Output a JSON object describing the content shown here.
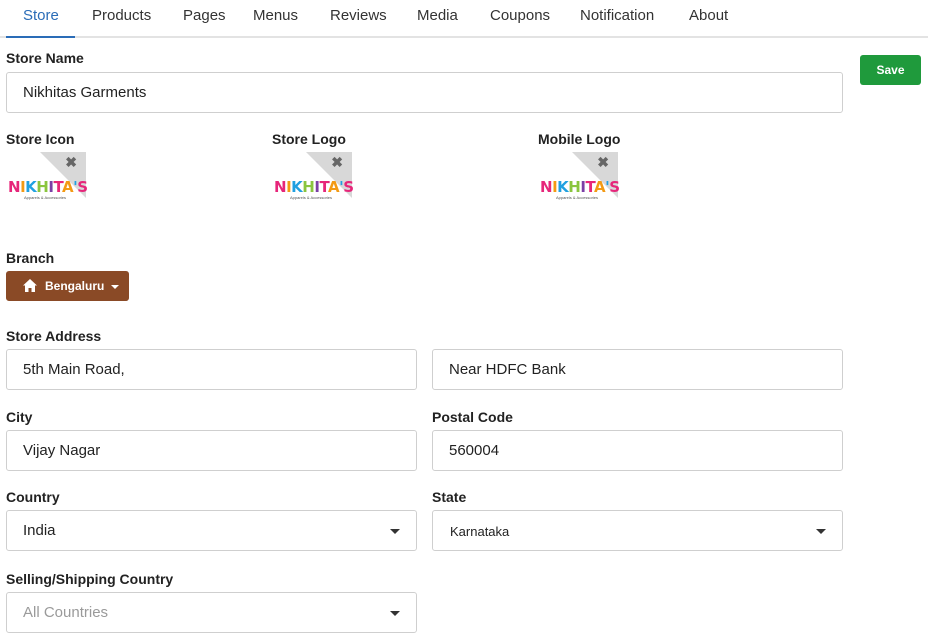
{
  "tabs": [
    {
      "label": "Store",
      "active": true
    },
    {
      "label": "Products"
    },
    {
      "label": "Pages"
    },
    {
      "label": "Menus"
    },
    {
      "label": "Reviews"
    },
    {
      "label": "Media"
    },
    {
      "label": "Coupons"
    },
    {
      "label": "Notification"
    },
    {
      "label": "About"
    }
  ],
  "save_label": "Save",
  "store_name": {
    "label": "Store Name",
    "value": "Nikhitas Garments"
  },
  "images": {
    "icon_label": "Store Icon",
    "logo_label": "Store Logo",
    "mobile_label": "Mobile Logo",
    "logo_text": "NIKHITA'S",
    "logo_subtext": "Apparels & Accessories",
    "remove_glyph": "✖"
  },
  "branch": {
    "label": "Branch",
    "value": "Bengaluru",
    "icon": "home-icon"
  },
  "address": {
    "label": "Store Address",
    "line1": "5th Main Road,",
    "line2": "Near HDFC Bank"
  },
  "city": {
    "label": "City",
    "value": "Vijay Nagar"
  },
  "postal": {
    "label": "Postal Code",
    "value": "560004"
  },
  "country": {
    "label": "Country",
    "value": "India"
  },
  "state": {
    "label": "State",
    "value": "Karnataka"
  },
  "selling": {
    "label": "Selling/Shipping Country",
    "placeholder": "All Countries"
  },
  "colors": {
    "accent": "#2a6cb7",
    "save": "#1f9a3c",
    "branch": "#8a4a26"
  }
}
